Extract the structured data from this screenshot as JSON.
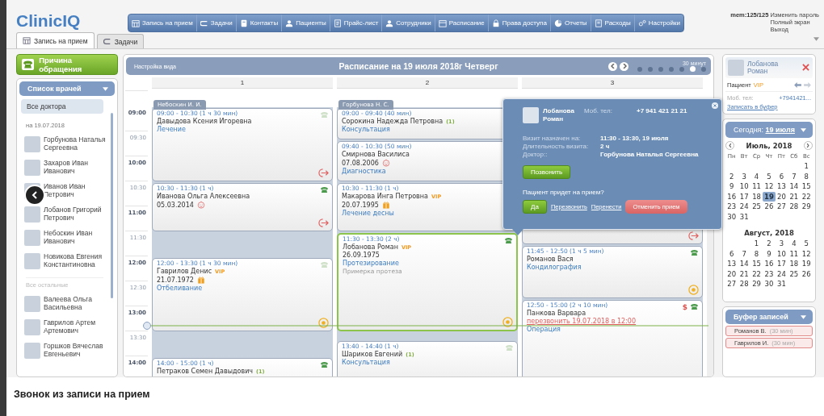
{
  "header": {
    "logo": "ClinicIQ",
    "nav": [
      {
        "label": "Запись на прием"
      },
      {
        "label": "Задачи"
      },
      {
        "label": "Контакты"
      },
      {
        "label": "Пациенты"
      },
      {
        "label": "Прайс-лист"
      },
      {
        "label": "Сотрудники"
      },
      {
        "label": "Расписание"
      },
      {
        "label": "Права доступа"
      },
      {
        "label": "Отчеты"
      },
      {
        "label": "Расходы"
      },
      {
        "label": "Настройки"
      }
    ],
    "memory": "mem:125/125",
    "links": [
      "Изменить пароль",
      "Полный экран",
      "Выход"
    ]
  },
  "tabs": [
    {
      "label": "Запись на прием",
      "selected": true
    },
    {
      "label": "Задачи",
      "selected": false
    }
  ],
  "left": {
    "reason_button": "Причина обращения",
    "list_title": "Список врачей",
    "all_item": {
      "label": "Все доктора",
      "selected": true
    },
    "date_label": "на 19.07.2018",
    "doctors": [
      {
        "name": "Горбунова Наталья Сергеевна"
      },
      {
        "name": "Захаров Иван Иванович"
      },
      {
        "name": "Иванов Иван Петрович"
      },
      {
        "name": "Лобанов Григорий Петрович"
      },
      {
        "name": "Небоскин Иван Иванович"
      },
      {
        "name": "Новикова Евгения Константиновна"
      }
    ],
    "others_label": "Все остальные",
    "others": [
      {
        "name": "Валеева Ольга Васильевна"
      },
      {
        "name": "Гаврилов Артем Артемович"
      },
      {
        "name": "Горшков Вячеслав Евгеньевич"
      }
    ]
  },
  "schedule": {
    "view_settings": "Настройка вида",
    "title": "Расписание на 19 июля 2018г Четверг",
    "scale": {
      "label": "30 минут",
      "steps": [
        {
          "selected": false
        },
        {
          "selected": false
        },
        {
          "selected": false
        },
        {
          "selected": false
        },
        {
          "selected": false
        },
        {
          "selected": true
        },
        {
          "selected": false
        }
      ]
    },
    "times": [
      {
        "label": "09:00",
        "major": true
      },
      {
        "label": "09:30",
        "major": false
      },
      {
        "label": "10:00",
        "major": true
      },
      {
        "label": "10:30",
        "major": false
      },
      {
        "label": "11:00",
        "major": true
      },
      {
        "label": "11:30",
        "major": false
      },
      {
        "label": "12:00",
        "major": true
      },
      {
        "label": "12:30",
        "major": false
      },
      {
        "label": "13:00",
        "major": true
      },
      {
        "label": "13:30",
        "major": false
      },
      {
        "label": "14:00",
        "major": true
      }
    ],
    "columns": [
      {
        "number": "1",
        "doctor": "Небоскин И. И.",
        "events": [
          {
            "kind": "visit",
            "time": "09:00 - 10:30 (1 ч 30 мин)",
            "patient": "Давыдова Ксения Игоревна",
            "service": "Лечение",
            "call_confirmed": false,
            "departed": true,
            "in_progress": false,
            "selected": false
          },
          {
            "kind": "visit",
            "time": "10:30 - 11:30 (1 ч)",
            "patient": "Иванова Ольга Алексеевна",
            "birth_date": "05.03.2014",
            "child": true,
            "birthday_soon": false,
            "call_confirmed": true,
            "departed": true,
            "in_progress": false,
            "selected": false
          },
          {
            "kind": "visit",
            "time": "12:00 - 13:30 (1 ч 30 мин)",
            "patient": "Гаврилов Денис",
            "tag": {
              "text": "VIP",
              "kind": "vip"
            },
            "birth_date": "21.07.1972",
            "child": false,
            "birthday_soon": true,
            "service": "Отбеливание",
            "call_confirmed": false,
            "departed": false,
            "in_progress": true,
            "selected": false
          },
          {
            "kind": "visit",
            "time": "14:00 - 15:00 (1 ч)",
            "patient": "Петраков Семен Давыдович",
            "tag": {
              "text": "(1)",
              "kind": "visits"
            },
            "call_confirmed": true,
            "selected": false
          }
        ]
      },
      {
        "number": "2",
        "doctor": "Горбунова Н. С.",
        "events": [
          {
            "kind": "visit",
            "time": "09:00 - 09:40 (40 мин)",
            "patient": "Сорокина Надежда Петровна",
            "tag": {
              "text": "(1)",
              "kind": "visits"
            },
            "service": "Консультация",
            "selected": false
          },
          {
            "kind": "visit",
            "time": "09:40 - 10:30 (50 мин)",
            "patient": "Смирнова Василиса",
            "birth_date": "07.08.2006",
            "child": true,
            "birthday_soon": false,
            "service": "Диагностика",
            "selected": false
          },
          {
            "kind": "visit",
            "time": "10:30 - 11:30 (1 ч)",
            "patient": "Макарова Инга Петровна",
            "tag": {
              "text": "VIP",
              "kind": "vip"
            },
            "birth_date": "20.07.1995",
            "child": false,
            "birthday_soon": true,
            "service": "Лечение десны",
            "selected": false
          },
          {
            "kind": "visit",
            "time": "11:30 - 13:30 (2 ч)",
            "patient": "Лобанова Роман",
            "tag": {
              "text": "VIP",
              "kind": "vip"
            },
            "birth_date": "26.09.1975",
            "child": false,
            "birthday_soon": false,
            "service": "Протезирование",
            "note": "Примерка протеза",
            "call_confirmed": true,
            "departed": false,
            "in_progress": true,
            "selected": true
          },
          {
            "kind": "visit",
            "time": "13:40 - 14:40 (1 ч)",
            "patient": "Шариков Евгений",
            "tag": {
              "text": "(1)",
              "kind": "visits"
            },
            "service": "Консультация",
            "call_confirmed": false,
            "selected": false
          }
        ]
      },
      {
        "number": "3",
        "events": [
          {
            "kind": "covered",
            "departed": true,
            "in_progress": false,
            "selected": false
          },
          {
            "kind": "visit",
            "time": "11:45 - 12:50 (1 ч 5 мин)",
            "patient": "Романов Вася",
            "service": "Кондилография",
            "call_confirmed": true,
            "departed": false,
            "in_progress": true,
            "selected": false
          },
          {
            "kind": "visit",
            "time": "12:50 - 15:00 (2 ч 10 мин)",
            "patient": "Панкова Варвара",
            "callback": "перезвонить 19.07.2018 в 12:00",
            "service": "Операция",
            "payment_mark": "$",
            "call_confirmed": true,
            "selected": false
          }
        ]
      }
    ]
  },
  "popup": {
    "patient_name": "Лобанова Роман",
    "phone_label": "Моб. тел:",
    "phone": "+7 941 421 21 21",
    "details": [
      {
        "label": "Визит назначен на:",
        "value": "11:30 - 13:30, 19 июля"
      },
      {
        "label": "Длительность визита:",
        "value": "2 ч"
      },
      {
        "label": "Доктор::",
        "value": "Горбунова Наталья Сергеевна"
      }
    ],
    "call_button": "Позвонить",
    "question": "Пациент придет на прием?",
    "actions": [
      {
        "label": "Да",
        "kind": "confirm"
      },
      {
        "label": "Перезвонить",
        "kind": "link"
      },
      {
        "label": "Перенести",
        "kind": "link"
      },
      {
        "label": "Отменить прием",
        "kind": "cancel"
      }
    ]
  },
  "patient_card": {
    "name": "Лобанова Роман",
    "type_label": "Пациент",
    "tag": "VIP",
    "phone_label": "Моб. тел:",
    "phone": "+7941421...",
    "buffer_link": "Записать в буфер"
  },
  "calendar": {
    "today_label": "Сегодня:",
    "today_date": "19 июля",
    "weekdays": [
      "Пн",
      "Вт",
      "Ср",
      "Чт",
      "Пт",
      "Сб",
      "Вс"
    ],
    "months": [
      {
        "title": "Июль, 2018",
        "weeks": [
          {
            "kind": "first",
            "days": [
              {
                "day": "1",
                "selected": false
              }
            ]
          },
          {
            "kind": "full",
            "days": [
              {
                "day": "2",
                "selected": false
              },
              {
                "day": "3",
                "selected": false
              },
              {
                "day": "4",
                "selected": false
              },
              {
                "day": "5",
                "selected": false
              },
              {
                "day": "6",
                "selected": false
              },
              {
                "day": "7",
                "selected": false
              },
              {
                "day": "8",
                "selected": false
              }
            ]
          },
          {
            "kind": "full",
            "days": [
              {
                "day": "9",
                "selected": false
              },
              {
                "day": "10",
                "selected": false
              },
              {
                "day": "11",
                "selected": false
              },
              {
                "day": "12",
                "selected": false
              },
              {
                "day": "13",
                "selected": false
              },
              {
                "day": "14",
                "selected": false
              },
              {
                "day": "15",
                "selected": false
              }
            ]
          },
          {
            "kind": "full",
            "days": [
              {
                "day": "16",
                "selected": false
              },
              {
                "day": "17",
                "selected": false
              },
              {
                "day": "18",
                "selected": false
              },
              {
                "day": "19",
                "selected": true
              },
              {
                "day": "20",
                "selected": false
              },
              {
                "day": "21",
                "selected": false
              },
              {
                "day": "22",
                "selected": false
              }
            ]
          },
          {
            "kind": "full",
            "days": [
              {
                "day": "23",
                "selected": false
              },
              {
                "day": "24",
                "selected": false
              },
              {
                "day": "25",
                "selected": false
              },
              {
                "day": "26",
                "selected": false
              },
              {
                "day": "27",
                "selected": false
              },
              {
                "day": "28",
                "selected": false
              },
              {
                "day": "29",
                "selected": false
              }
            ]
          },
          {
            "kind": "last",
            "days": [
              {
                "day": "30",
                "selected": false
              },
              {
                "day": "31",
                "selected": false
              }
            ]
          }
        ]
      },
      {
        "title": "Август, 2018",
        "weeks": [
          {
            "kind": "first",
            "days": [
              {
                "day": "1",
                "selected": false
              },
              {
                "day": "2",
                "selected": false
              },
              {
                "day": "3",
                "selected": false
              },
              {
                "day": "4",
                "selected": false
              },
              {
                "day": "5",
                "selected": false
              }
            ]
          },
          {
            "kind": "full",
            "days": [
              {
                "day": "6",
                "selected": false
              },
              {
                "day": "7",
                "selected": false
              },
              {
                "day": "8",
                "selected": false
              },
              {
                "day": "9",
                "selected": false
              },
              {
                "day": "10",
                "selected": false
              },
              {
                "day": "11",
                "selected": false
              },
              {
                "day": "12",
                "selected": false
              }
            ]
          },
          {
            "kind": "full",
            "days": [
              {
                "day": "13",
                "selected": false
              },
              {
                "day": "14",
                "selected": false
              },
              {
                "day": "15",
                "selected": false
              },
              {
                "day": "16",
                "selected": false
              },
              {
                "day": "17",
                "selected": false
              },
              {
                "day": "18",
                "selected": false
              },
              {
                "day": "19",
                "selected": false
              }
            ]
          },
          {
            "kind": "full",
            "days": [
              {
                "day": "20",
                "selected": false
              },
              {
                "day": "21",
                "selected": false
              },
              {
                "day": "22",
                "selected": false
              },
              {
                "day": "23",
                "selected": false
              },
              {
                "day": "24",
                "selected": false
              },
              {
                "day": "25",
                "selected": false
              },
              {
                "day": "26",
                "selected": false
              }
            ]
          },
          {
            "kind": "last",
            "days": [
              {
                "day": "27",
                "selected": false
              },
              {
                "day": "28",
                "selected": false
              },
              {
                "day": "29",
                "selected": false
              },
              {
                "day": "30",
                "selected": false
              },
              {
                "day": "31",
                "selected": false
              }
            ]
          }
        ]
      }
    ]
  },
  "buffer": {
    "title": "Буфер записей",
    "items": [
      {
        "name": "Романов В.",
        "duration": "(30 мин)"
      },
      {
        "name": "Гаврилов И.",
        "duration": "(30 мин)"
      }
    ]
  },
  "caption": "Звонок из записи на прием"
}
